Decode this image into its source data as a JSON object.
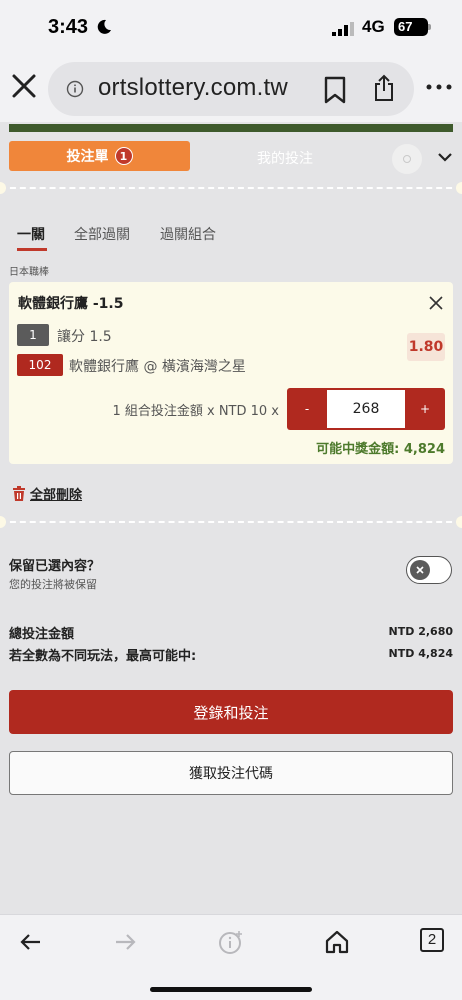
{
  "status_bar": {
    "time": "3:43",
    "network": "4G",
    "battery": "67"
  },
  "browser": {
    "url": "ortslottery.com.tw",
    "open_tabs": "2"
  },
  "bet_slip": {
    "tab_betslip": "投注單",
    "tab_betslip_count": "1",
    "tab_my_bets": "我的投注",
    "market_tabs": [
      "一關",
      "全部過關",
      "過關組合"
    ],
    "league": "日本職棒",
    "selection": {
      "title": "軟體銀行鷹 -1.5",
      "market_number": "1",
      "market": "讓分 1.5",
      "match_number": "102",
      "match": "軟體銀行鷹 @ 橫濱海灣之星",
      "odds": "1.80"
    },
    "stake_label": "1 組合投注金額 x NTD 10 x",
    "stake_minus": "-",
    "stake_value": "268",
    "stake_plus": "+",
    "potential_win": "可能中獎金額: 4,824",
    "delete_all": "全部刪除",
    "retain_title": "保留已選內容？",
    "retain_subtitle": "您的投注將被保留",
    "retain_enabled": false,
    "total_stake_label": "總投注金額",
    "total_stake_value": "NTD 2,680",
    "max_win_label": "若全數為不同玩法，最高可能中:",
    "max_win_value": "NTD 4,824",
    "login_button": "登錄和投注",
    "code_button": "獲取投注代碼"
  },
  "colors": {
    "accent_orange": "#f0863a",
    "primary_red": "#b0291f",
    "win_green": "#4d7a2c",
    "card_bg": "#fcfae9"
  }
}
